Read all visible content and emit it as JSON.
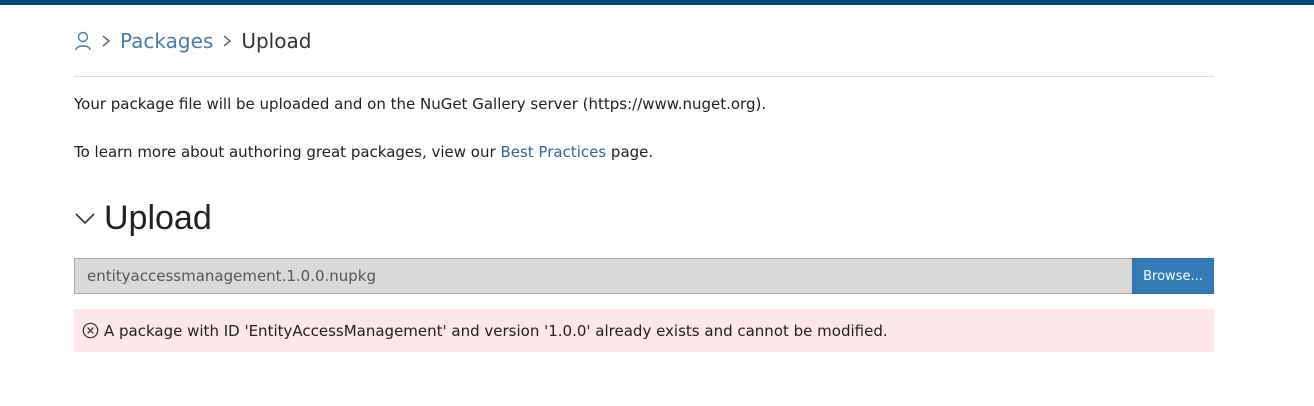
{
  "colors": {
    "top_bar": "#004880",
    "link": "#4a7bb0",
    "button_bg": "#337ab7",
    "alert_bg": "#fde7e9"
  },
  "breadcrumb": {
    "icon": "user-icon",
    "separator_icon": "chevron-right-icon",
    "items": [
      {
        "label": "Packages"
      },
      {
        "label": "Upload"
      }
    ]
  },
  "intro": {
    "line1": "Your package file will be uploaded and on the NuGet Gallery server (https://www.nuget.org).",
    "line2_prefix": "To learn more about authoring great packages, view our ",
    "line2_link": "Best Practices",
    "line2_suffix": " page."
  },
  "upload_section": {
    "title": "Upload",
    "toggle_icon": "chevron-down-icon",
    "file_value": "entityaccessmanagement.1.0.0.nupkg",
    "browse_label": "Browse..."
  },
  "error": {
    "icon": "error-circle-icon",
    "message": "A package with ID 'EntityAccessManagement' and version '1.0.0' already exists and cannot be modified."
  }
}
